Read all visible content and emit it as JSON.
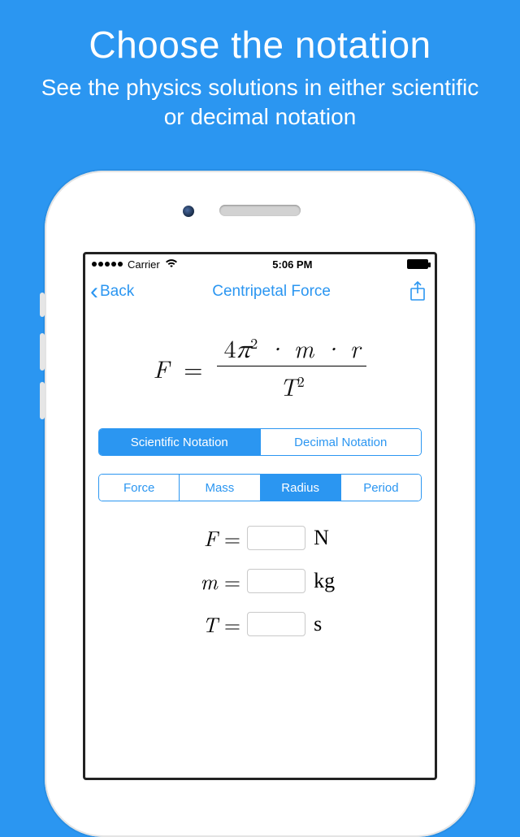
{
  "promo": {
    "title": "Choose the notation",
    "subtitle": "See the physics solutions in either scientific or decimal notation"
  },
  "statusbar": {
    "carrier": "Carrier",
    "time": "5:06 PM"
  },
  "nav": {
    "back": "Back",
    "title": "Centripetal Force"
  },
  "formula": {
    "lhs": "F",
    "numerator": "4π² · m · r",
    "denominator": "T²"
  },
  "seg_notation": {
    "items": [
      "Scientific Notation",
      "Decimal Notation"
    ],
    "active_index": 0
  },
  "seg_variable": {
    "items": [
      "Force",
      "Mass",
      "Radius",
      "Period"
    ],
    "active_index": 2
  },
  "inputs": [
    {
      "var": "F",
      "value": "",
      "unit": "N"
    },
    {
      "var": "m",
      "value": "",
      "unit": "kg"
    },
    {
      "var": "T",
      "value": "",
      "unit": "s"
    }
  ]
}
